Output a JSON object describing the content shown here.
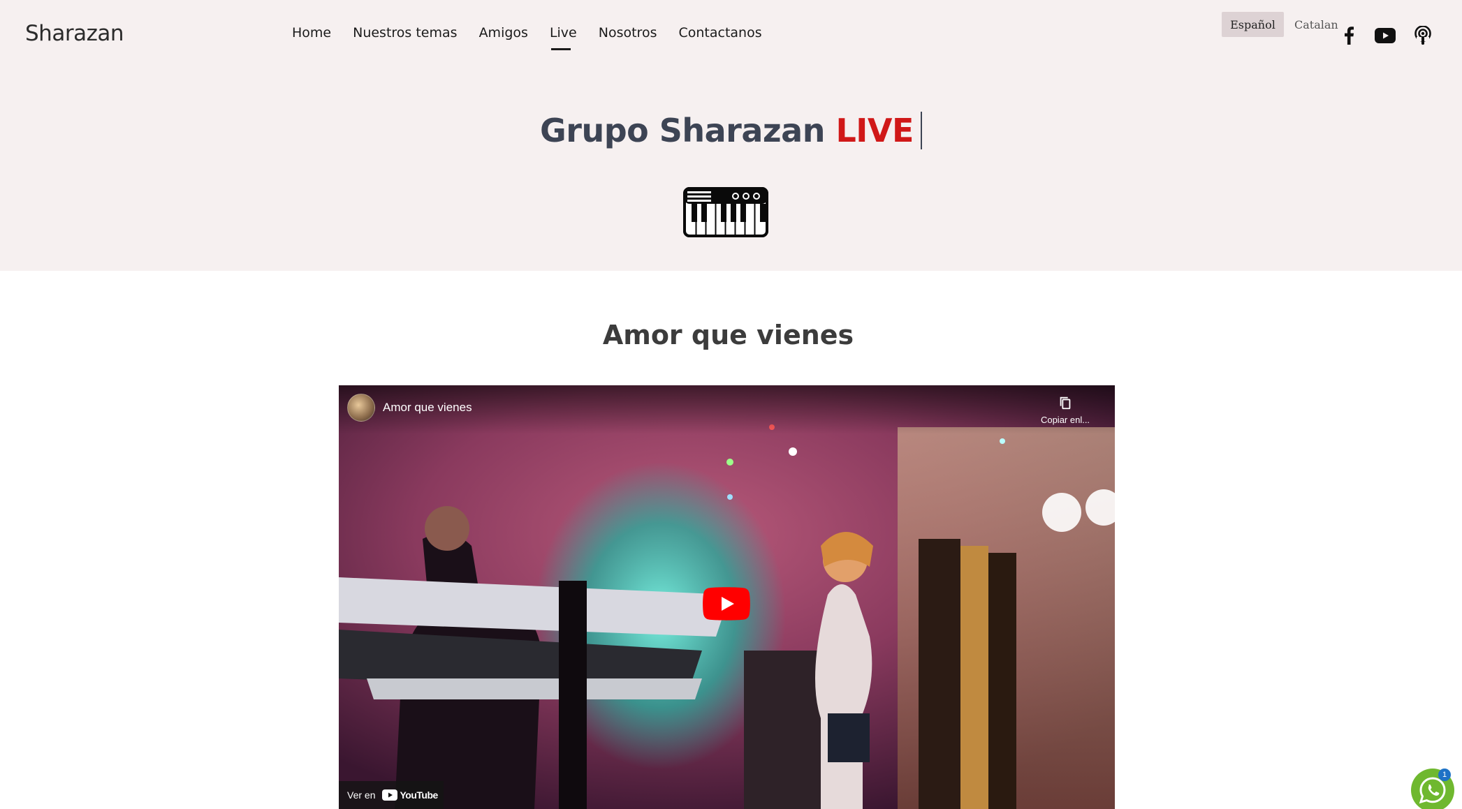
{
  "brand": {
    "logo_text": "Sharazan"
  },
  "nav": {
    "items": [
      {
        "label": "Home"
      },
      {
        "label": "Nuestros temas"
      },
      {
        "label": "Amigos"
      },
      {
        "label": "Live",
        "active": true
      },
      {
        "label": "Nosotros"
      },
      {
        "label": "Contactanos"
      }
    ]
  },
  "languages": {
    "selected": "Español",
    "other": "Catalan"
  },
  "social": {
    "icons": [
      "facebook-icon",
      "youtube-icon",
      "podcast-icon"
    ]
  },
  "hero": {
    "title_main": "Grupo Sharazan",
    "title_accent": "LIVE",
    "icon": "keyboard-piano-icon",
    "accent_color": "#d01818"
  },
  "content": {
    "song_title": "Amor que vienes"
  },
  "video": {
    "title": "Amor que vienes",
    "copy_link_label": "Copiar enl...",
    "watch_on_label": "Ver en",
    "platform": "YouTube"
  },
  "whatsapp": {
    "badge_count": "1",
    "color": "#6fb82f"
  }
}
